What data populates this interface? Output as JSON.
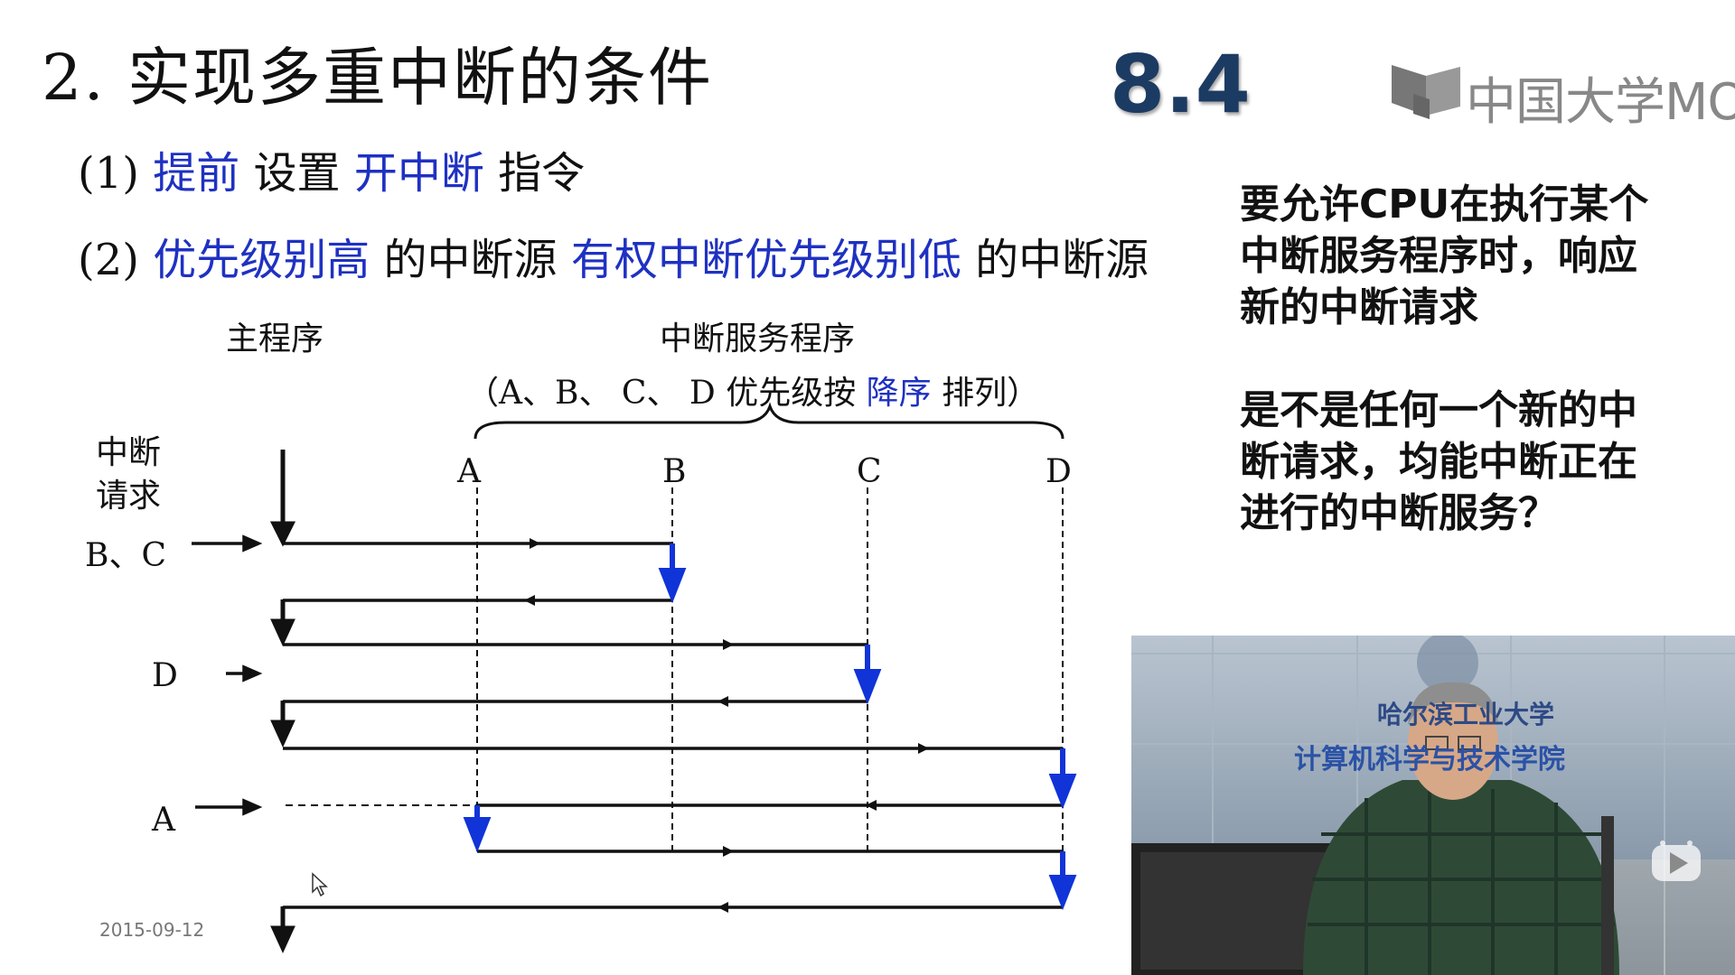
{
  "slide": {
    "title": "2. 实现多重中断的条件",
    "section": "8.4",
    "logo_text": "中国大学MOOC",
    "cond1": {
      "prefix": "(1)",
      "b1": "提前",
      "t1": "设置",
      "b2": "开中断",
      "t2": "指令"
    },
    "cond2": {
      "prefix": "(2)",
      "b1": "优先级别高",
      "t1": "的中断源",
      "b2": "有权中断优先级别低",
      "t2": "的中断源"
    },
    "side_note": {
      "p1": [
        "要允许CPU在执行某个",
        "中断服务程序时，响应",
        "新的中断请求"
      ],
      "p2": [
        "是不是任何一个新的中",
        "断请求，均能中断正在",
        "进行的中断服务？"
      ]
    },
    "date": "2015-09-12",
    "colors": {
      "blue": "#1f31c2",
      "arrow_blue": "#1034d8",
      "section": "#1c3b63"
    }
  },
  "diagram": {
    "main_label": "主程序",
    "isr_label": "中断服务程序",
    "order_note": {
      "pre": "（A、B、 C、 D 优先级按",
      "blue": "降序",
      "post": "排列）"
    },
    "req_label": [
      "中断",
      "请求"
    ],
    "columns": [
      "A",
      "B",
      "C",
      "D"
    ],
    "requests": [
      "B、C",
      "D",
      "A"
    ]
  },
  "video": {
    "wall_text_1": "哈尔滨工业大学",
    "wall_text_2": "计算机科学与技术学院"
  },
  "icons": [
    "mooc-logo-icon",
    "play-icon",
    "mouse-cursor-icon"
  ]
}
